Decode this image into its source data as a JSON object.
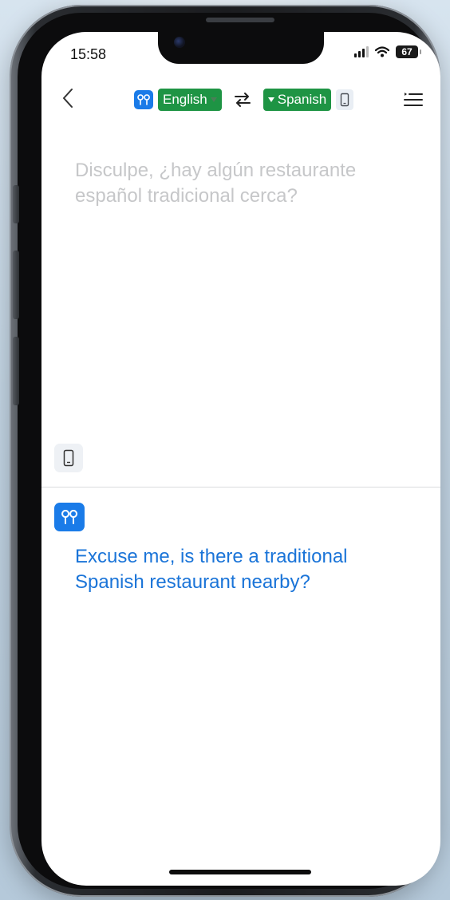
{
  "status_bar": {
    "time": "15:58",
    "battery": "67"
  },
  "header": {
    "back_icon": "chevron-left-icon",
    "source_language": "English",
    "target_language": "Spanish",
    "swap_icon": "swap-arrows-icon",
    "menu_icon": "list-menu-icon"
  },
  "source_panel": {
    "text": "Disculpe, ¿hay algún restaurante español tradicional cerca?",
    "device_icon": "phone-icon"
  },
  "target_panel": {
    "text": "Excuse me, is there a traditional Spanish restaurant nearby?",
    "device_icon": "earbuds-icon"
  },
  "colors": {
    "accent_blue": "#1a7be8",
    "language_green": "#1e9444",
    "translation_text": "#1a74d8",
    "source_text": "#c6c7c9"
  }
}
